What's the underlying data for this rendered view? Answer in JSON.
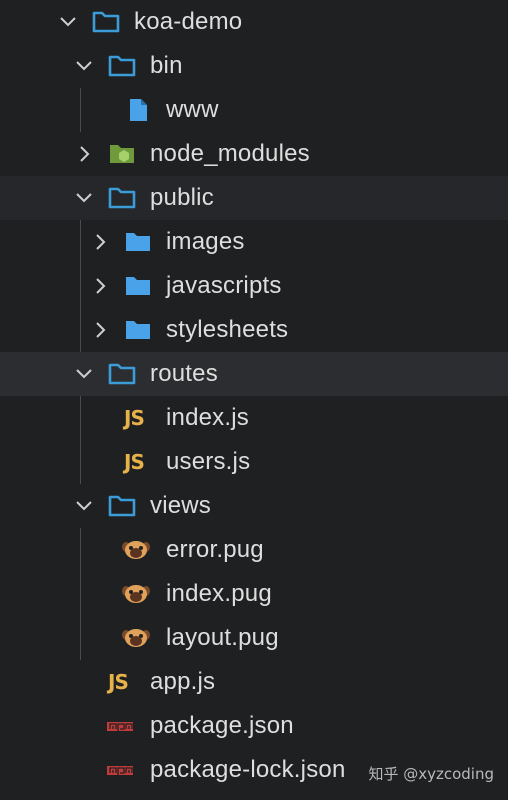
{
  "explorer": {
    "items": [
      {
        "label": "koa-demo",
        "type": "folder-open",
        "depth": 0
      },
      {
        "label": "bin",
        "type": "folder-open",
        "depth": 1
      },
      {
        "label": "www",
        "type": "file",
        "depth": 2
      },
      {
        "label": "node_modules",
        "type": "node-folder-closed",
        "depth": 1
      },
      {
        "label": "public",
        "type": "folder-open",
        "depth": 1
      },
      {
        "label": "images",
        "type": "folder-closed",
        "depth": 2
      },
      {
        "label": "javascripts",
        "type": "folder-closed",
        "depth": 2
      },
      {
        "label": "stylesheets",
        "type": "folder-closed",
        "depth": 2
      },
      {
        "label": "routes",
        "type": "folder-open",
        "depth": 1
      },
      {
        "label": "index.js",
        "type": "js",
        "depth": 2
      },
      {
        "label": "users.js",
        "type": "js",
        "depth": 2
      },
      {
        "label": "views",
        "type": "folder-open",
        "depth": 1
      },
      {
        "label": "error.pug",
        "type": "pug",
        "depth": 2
      },
      {
        "label": "index.pug",
        "type": "pug",
        "depth": 2
      },
      {
        "label": "layout.pug",
        "type": "pug",
        "depth": 2
      },
      {
        "label": "app.js",
        "type": "js",
        "depth": 1
      },
      {
        "label": "package.json",
        "type": "npm",
        "depth": 1
      },
      {
        "label": "package-lock.json",
        "type": "npm",
        "depth": 1
      }
    ],
    "js_badge": "JS",
    "icons": {
      "folder": "folder-icon",
      "file": "file-icon",
      "node": "nodejs-icon",
      "js": "javascript-icon",
      "pug": "pug-icon",
      "npm": "npm-icon"
    },
    "colors": {
      "folder_outline": "#3b9cd8",
      "folder_filled": "#4aa3e8",
      "file": "#4aa3e8",
      "js": "#e8b24a",
      "npm": "#c23b3b",
      "node": "#8cc84b",
      "pug": "#e0a15a"
    }
  },
  "watermark": "知乎 @xyzcoding"
}
